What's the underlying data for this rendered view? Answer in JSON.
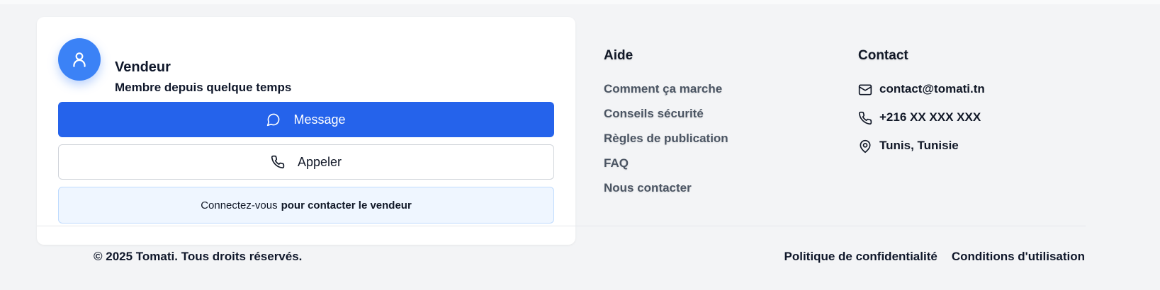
{
  "seller": {
    "name": "Vendeur",
    "subtitle": "Membre depuis quelque temps",
    "message_label": "Message",
    "call_label": "Appeler",
    "login_link": "Connectez-vous",
    "login_note": "pour contacter le vendeur"
  },
  "footer": {
    "aide": {
      "title": "Aide",
      "items": [
        "Comment ça marche",
        "Conseils sécurité",
        "Règles de publication",
        "FAQ",
        "Nous contacter"
      ]
    },
    "contact": {
      "title": "Contact",
      "email": "contact@tomati.tn",
      "phone": "+216 XX XXX XXX",
      "location": "Tunis, Tunisie"
    },
    "copyright": "© 2025 Tomati. Tous droits réservés.",
    "legal": {
      "privacy": "Politique de confidentialité",
      "terms": "Conditions d'utilisation"
    }
  },
  "icons": {
    "avatar": "user-icon",
    "message": "chat-bubble-icon",
    "call": "phone-icon",
    "email": "mail-icon",
    "phone": "phone-icon",
    "location": "map-pin-icon"
  },
  "colors": {
    "primary": "#2563eb",
    "avatar": "#3b82f6",
    "page_bg": "#f3f4f6",
    "note_bg": "#eff6ff",
    "link_gray": "#4b5563"
  }
}
